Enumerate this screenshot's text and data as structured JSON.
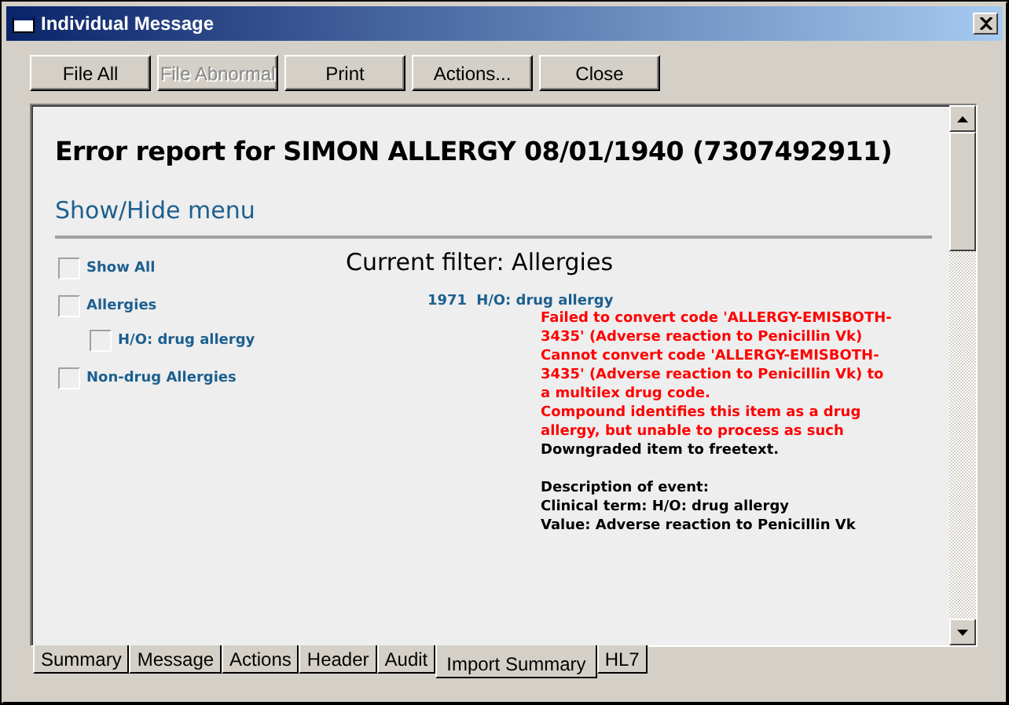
{
  "window": {
    "title": "Individual Message"
  },
  "toolbar": [
    {
      "label": "File All",
      "disabled": false
    },
    {
      "label": "File Abnormal",
      "disabled": true
    },
    {
      "label": "Print",
      "disabled": false
    },
    {
      "label": "Actions...",
      "disabled": false
    },
    {
      "label": "Close",
      "disabled": false
    }
  ],
  "report": {
    "heading": "Error report for SIMON ALLERGY 08/01/1940 (7307492911)",
    "menu_link": "Show/Hide menu",
    "filters": [
      {
        "label": "Show All",
        "checked": false
      },
      {
        "label": "Allergies",
        "checked": false,
        "children": [
          {
            "label": "H/O: drug allergy",
            "checked": false
          }
        ]
      },
      {
        "label": "Non-drug Allergies",
        "checked": false
      }
    ],
    "current_filter": "Current filter: Allergies",
    "entry": {
      "year": "1971",
      "term": "H/O: drug allergy",
      "messages": [
        {
          "kind": "error",
          "text": "Failed to convert code 'ALLERGY-EMISBOTH-3435' (Adverse reaction to Penicillin Vk)"
        },
        {
          "kind": "error",
          "text": "Cannot convert code 'ALLERGY-EMISBOTH-3435' (Adverse reaction to Penicillin Vk) to a multilex drug code."
        },
        {
          "kind": "error",
          "text": "Compound identifies this item as a drug allergy, but unable to process as such"
        },
        {
          "kind": "info",
          "text": "Downgraded item to freetext."
        },
        {
          "kind": "gap"
        },
        {
          "kind": "info",
          "text": "Description of event:"
        },
        {
          "kind": "info",
          "text": "Clinical term: H/O: drug allergy"
        },
        {
          "kind": "info",
          "text": "Value: Adverse reaction to Penicillin Vk"
        }
      ]
    }
  },
  "tabs": [
    {
      "label": "Summary",
      "selected": false
    },
    {
      "label": "Message",
      "selected": false
    },
    {
      "label": "Actions",
      "selected": false
    },
    {
      "label": "Header",
      "selected": false
    },
    {
      "label": "Audit",
      "selected": false
    },
    {
      "label": "Import Summary",
      "selected": true
    },
    {
      "label": "HL7",
      "selected": false
    }
  ]
}
